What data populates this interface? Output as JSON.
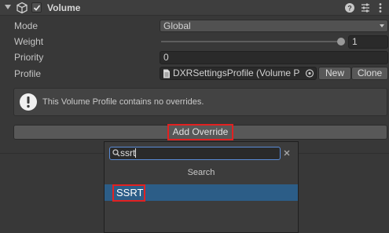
{
  "component": {
    "title": "Volume",
    "enabled": true,
    "icons": [
      "collapse-arrow-icon",
      "cube-icon",
      "help-icon",
      "preset-icon",
      "more-menu-icon"
    ]
  },
  "properties": {
    "mode": {
      "label": "Mode",
      "value": "Global"
    },
    "weight": {
      "label": "Weight",
      "value": "1",
      "slider_level": 1.0
    },
    "priority": {
      "label": "Priority",
      "value": "0"
    },
    "profile": {
      "label": "Profile",
      "value": "DXRSettingsProfile (Volume P",
      "new_label": "New",
      "clone_label": "Clone"
    }
  },
  "help_box": {
    "text": "This Volume Profile contains no overrides."
  },
  "add_override": {
    "label": "Add Override"
  },
  "popup": {
    "search_value": "ssrt",
    "header": "Search",
    "results": [
      "SSRT"
    ]
  },
  "colors": {
    "background": "#383838",
    "selection": "#2c5d87",
    "highlight_outline": "#e22121",
    "focus_outline": "#5a8bd6"
  }
}
